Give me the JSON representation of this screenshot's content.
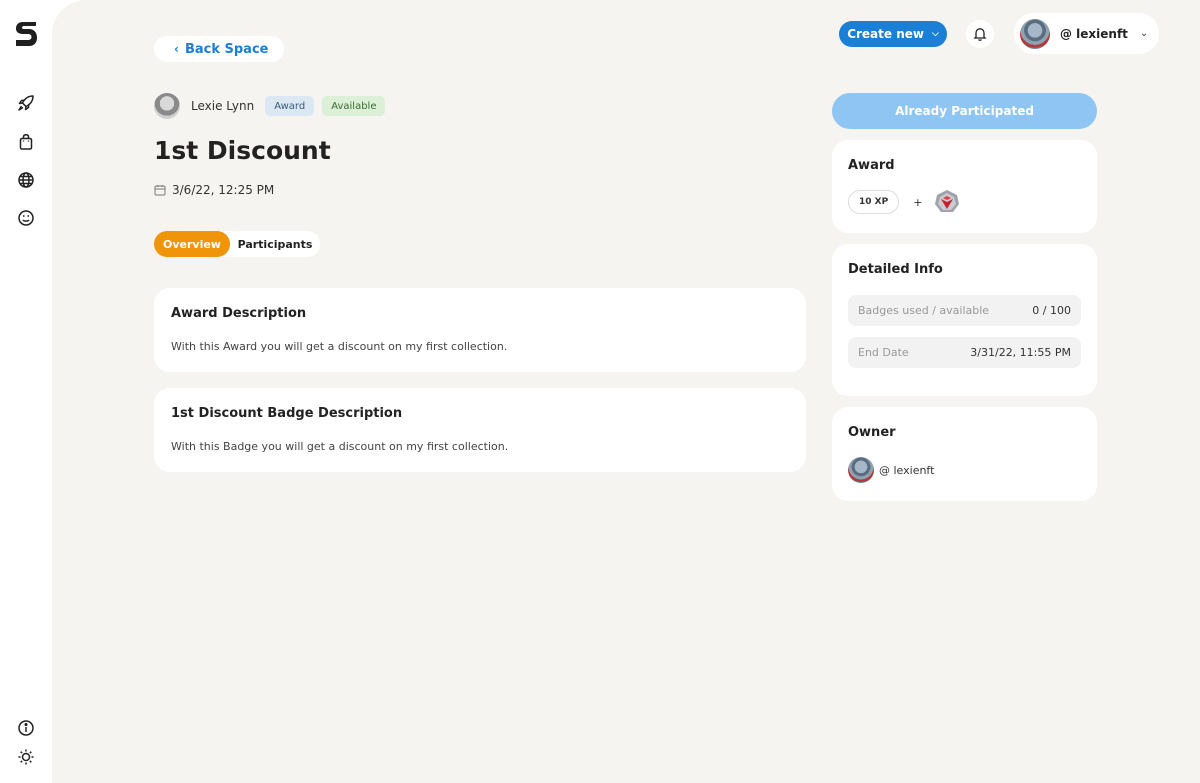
{
  "sidebar": {
    "icons": [
      "rocket-icon",
      "shopping-bag-icon",
      "globe-icon",
      "smiley-icon",
      "info-icon",
      "sun-icon"
    ]
  },
  "header": {
    "back_label": "Back Space",
    "create_label": "Create new",
    "username": "@ lexienft"
  },
  "award": {
    "author": "Lexie Lynn",
    "tags": [
      "Award",
      "Available"
    ],
    "title": "1st Discount",
    "date": "3/6/22, 12:25 PM",
    "tabs": [
      "Overview",
      "Participants"
    ],
    "active_tab": "Overview"
  },
  "descriptions": [
    {
      "title": "Award Description",
      "text": "With this Award you will get a discount on my first collection."
    },
    {
      "title": "1st Discount Badge Description",
      "text": "With this Badge you will get a discount on my first collection."
    }
  ],
  "side": {
    "participated_label": "Already Participated",
    "award_title": "Award",
    "xp": "10 XP",
    "plus": "+",
    "info_title": "Detailed Info",
    "info_rows": [
      {
        "label": "Badges used / available",
        "value": "0 / 100"
      },
      {
        "label": "End Date",
        "value": "3/31/22, 11:55 PM"
      }
    ],
    "owner_title": "Owner",
    "owner_name": "@ lexienft"
  },
  "colors": {
    "accent_blue": "#1a7fd6",
    "accent_orange": "#f0950a",
    "disabled_blue": "#8fc5f2",
    "background": "#f5f4f0"
  }
}
